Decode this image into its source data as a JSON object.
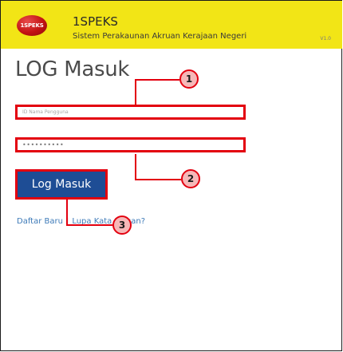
{
  "header": {
    "logo_text": "1SPEKS",
    "app_name": "1SPEKS",
    "app_subtitle": "Sistem Perakaunan Akruan Kerajaan Negeri",
    "version": "V1.0"
  },
  "login": {
    "title": "LOG Masuk",
    "username_value": "ID Nama Pengguna",
    "password_value": "••••••••••",
    "button_label": "Log Masuk",
    "register_link": "Daftar Baru",
    "separator": "|",
    "forgot_link": "Lupa Kata Laluan?"
  },
  "annotations": {
    "callout_1": "1",
    "callout_2": "2",
    "callout_3": "3"
  },
  "colors": {
    "header_bg": "#f2e516",
    "button_bg": "#1e4d95",
    "highlight": "#e3000f",
    "link": "#3d7ab8"
  }
}
